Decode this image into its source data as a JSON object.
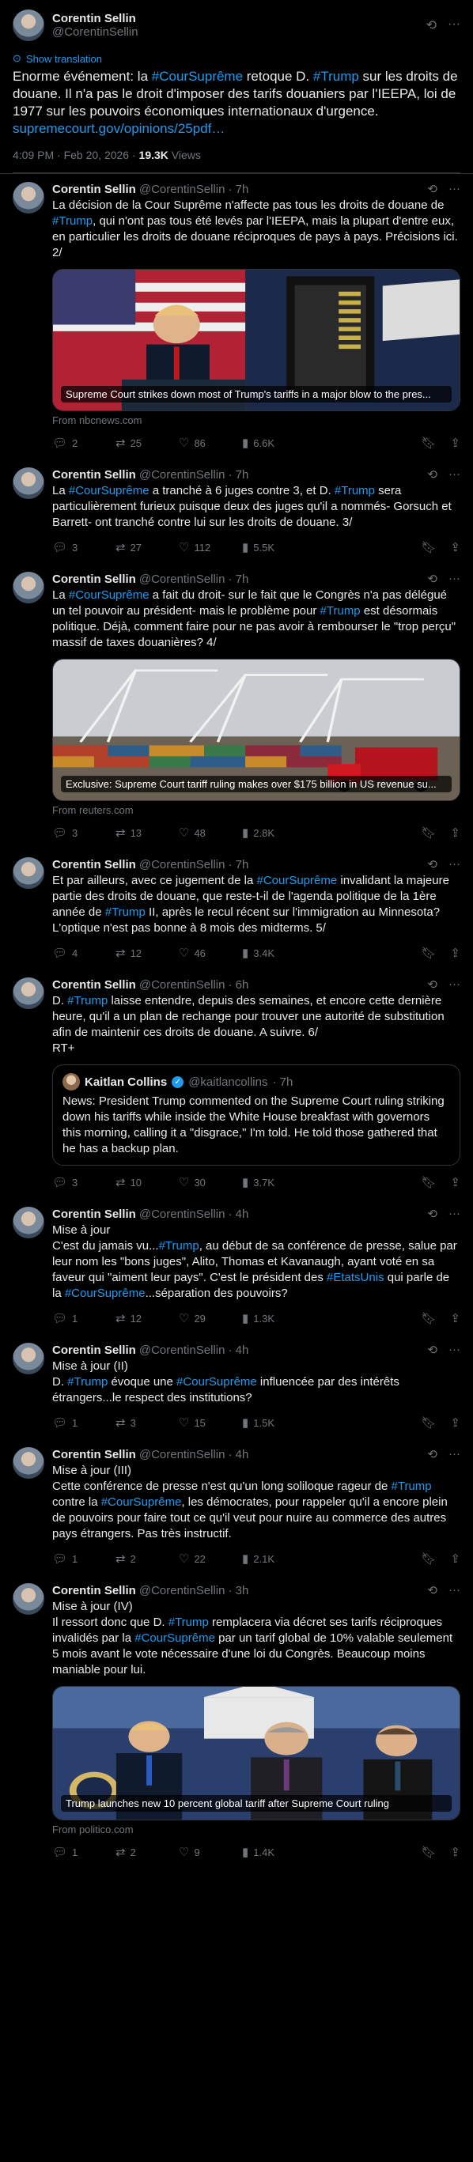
{
  "main": {
    "name": "Corentin Sellin",
    "handle": "@CorentinSellin",
    "translate": "Show translation",
    "text_parts": [
      "Enorme événement: la ",
      "#CourSuprême",
      " retoque D. ",
      "#Trump",
      " sur les droits de douane. Il n'a pas le droit d'imposer des tarifs douaniers par l'IEEPA, loi de 1977 sur les pouvoirs économiques internationaux d'urgence. "
    ],
    "link": "supremecourt.gov/opinions/25pdf…",
    "time": "4:09 PM · Feb 20, 2026 · ",
    "views": "19.3K",
    "views_label": " Views"
  },
  "replies": [
    {
      "name": "Corentin Sellin",
      "handle": "@CorentinSellin",
      "time": "· 7h",
      "text": [
        [
          "La décision de la Cour Suprême n'affecte pas tous les droits de douane de ",
          0
        ],
        [
          "#Trump",
          1
        ],
        [
          ", qui n'ont pas tous été levés par l'IEEPA, mais la plupart d'entre eux, en particulier les droits de douane réciproques de pays à pays. Précisions ici. 2/",
          0
        ]
      ],
      "media": {
        "caption": "Supreme Court strikes down most of Trump's tariffs in a major blow to the pres...",
        "from": "From nbcnews.com"
      },
      "replies": "2",
      "retweets": "25",
      "likes": "86",
      "views": "6.6K"
    },
    {
      "name": "Corentin Sellin",
      "handle": "@CorentinSellin",
      "time": "· 7h",
      "text": [
        [
          "La ",
          0
        ],
        [
          "#CourSuprême",
          1
        ],
        [
          " a tranché à 6 juges contre 3, et D. ",
          0
        ],
        [
          "#Trump",
          1
        ],
        [
          " sera particulièrement furieux puisque deux des juges qu'il a nommés- Gorsuch et Barrett- ont tranché contre lui sur les droits de douane. 3/",
          0
        ]
      ],
      "replies": "3",
      "retweets": "27",
      "likes": "112",
      "views": "5.5K"
    },
    {
      "name": "Corentin Sellin",
      "handle": "@CorentinSellin",
      "time": "· 7h",
      "text": [
        [
          "La ",
          0
        ],
        [
          "#CourSuprême",
          1
        ],
        [
          " a fait du droit- sur le fait que le Congrès n'a pas délégué un tel pouvoir au président- mais le problème pour ",
          0
        ],
        [
          "#Trump",
          1
        ],
        [
          " est désormais politique. Déjà, comment faire pour ne pas avoir à rembourser le \"trop perçu\" massif de taxes douanières? 4/",
          0
        ]
      ],
      "media": {
        "caption": "Exclusive: Supreme Court tariff ruling makes over $175 billion in US revenue su...",
        "from": "From reuters.com"
      },
      "replies": "3",
      "retweets": "13",
      "likes": "48",
      "views": "2.8K"
    },
    {
      "name": "Corentin Sellin",
      "handle": "@CorentinSellin",
      "time": "· 7h",
      "text": [
        [
          "Et par ailleurs, avec ce jugement de la ",
          0
        ],
        [
          "#CourSuprême",
          1
        ],
        [
          " invalidant la  majeure partie des droits de douane, que reste-t-il de l'agenda politique de la 1ère année de ",
          0
        ],
        [
          "#Trump",
          1
        ],
        [
          " II, après le recul récent sur l'immigration au Minnesota? L'optique n'est  pas bonne à 8 mois des midterms. 5/",
          0
        ]
      ],
      "replies": "4",
      "retweets": "12",
      "likes": "46",
      "views": "3.4K"
    },
    {
      "name": "Corentin Sellin",
      "handle": "@CorentinSellin",
      "time": "· 6h",
      "text": [
        [
          "D. ",
          0
        ],
        [
          "#Trump",
          1
        ],
        [
          " laisse entendre, depuis des semaines, et encore cette dernière heure, qu'il a un plan de rechange pour trouver une autorité de substitution afin de maintenir ces droits de douane. A suivre. 6/\nRT+",
          0
        ]
      ],
      "quote": {
        "name": "Kaitlan Collins",
        "handle": "@kaitlancollins",
        "time": "· 7h",
        "text": "News: President Trump commented on the Supreme Court ruling striking down his tariffs while inside the White House breakfast with governors this morning, calling it a \"disgrace,\" I'm told. He told those gathered that he has a backup plan."
      },
      "replies": "3",
      "retweets": "10",
      "likes": "30",
      "views": "3.7K"
    },
    {
      "name": "Corentin Sellin",
      "handle": "@CorentinSellin",
      "time": "· 4h",
      "text": [
        [
          "Mise à jour\nC'est du jamais vu...",
          0
        ],
        [
          "#Trump",
          1
        ],
        [
          ", au début de sa conférence de presse, salue par leur nom les \"bons juges\", Alito, Thomas et Kavanaugh, ayant voté en sa faveur qui \"aiment leur pays\". C'est le président des ",
          0
        ],
        [
          "#EtatsUnis",
          1
        ],
        [
          " qui parle de la ",
          0
        ],
        [
          "#CourSuprême",
          1
        ],
        [
          "...séparation des pouvoirs?",
          0
        ]
      ],
      "replies": "1",
      "retweets": "12",
      "likes": "29",
      "views": "1.3K"
    },
    {
      "name": "Corentin Sellin",
      "handle": "@CorentinSellin",
      "time": "· 4h",
      "text": [
        [
          "Mise à jour (II)\nD. ",
          0
        ],
        [
          "#Trump",
          1
        ],
        [
          " évoque une ",
          0
        ],
        [
          "#CourSuprême",
          1
        ],
        [
          " influencée par des intérêts étrangers...le respect des institutions?",
          0
        ]
      ],
      "replies": "1",
      "retweets": "3",
      "likes": "15",
      "views": "1.5K"
    },
    {
      "name": "Corentin Sellin",
      "handle": "@CorentinSellin",
      "time": "· 4h",
      "text": [
        [
          "Mise à jour (III)\nCette conférence de presse n'est qu'un long soliloque rageur de ",
          0
        ],
        [
          "#Trump",
          1
        ],
        [
          " contre la ",
          0
        ],
        [
          "#CourSuprême",
          1
        ],
        [
          ", les démocrates, pour rappeler qu'il a encore plein de pouvoirs pour faire tout ce qu'il veut pour nuire au commerce des autres pays étrangers. Pas très instructif.",
          0
        ]
      ],
      "replies": "1",
      "retweets": "2",
      "likes": "22",
      "views": "2.1K"
    },
    {
      "name": "Corentin Sellin",
      "handle": "@CorentinSellin",
      "time": "· 3h",
      "text": [
        [
          "Mise à jour (IV)\nIl ressort donc que D. ",
          0
        ],
        [
          "#Trump",
          1
        ],
        [
          " remplacera via décret ses tarifs réciproques invalidés par la ",
          0
        ],
        [
          "#CourSuprême",
          1
        ],
        [
          " par un tarif global de 10%  valable seulement 5 mois avant le vote nécessaire d'une loi du Congrès. Beaucoup moins maniable pour lui.",
          0
        ]
      ],
      "media": {
        "caption": "Trump launches new 10 percent global tariff after Supreme Court ruling",
        "from": "From politico.com"
      },
      "replies": "1",
      "retweets": "2",
      "likes": "9",
      "views": "1.4K"
    }
  ]
}
